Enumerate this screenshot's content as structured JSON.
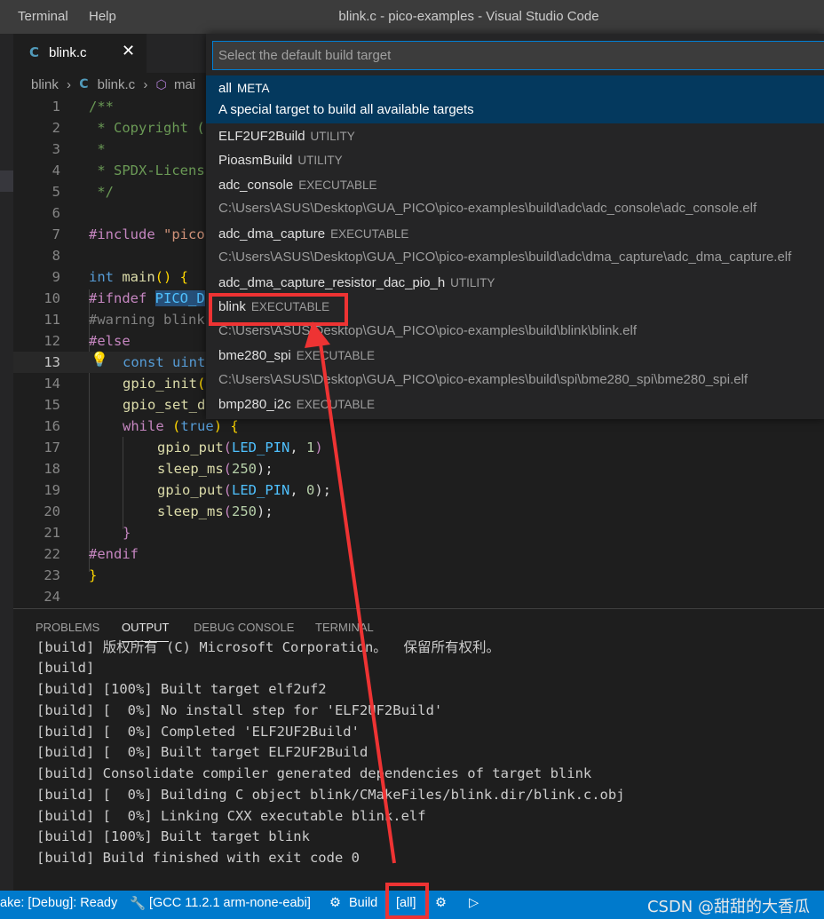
{
  "titlebar": {
    "menu_terminal": "Terminal",
    "menu_help": "Help",
    "title": "blink.c - pico-examples - Visual Studio Code"
  },
  "tab": {
    "icon": "C",
    "label": "blink.c",
    "close": "✕"
  },
  "breadcrumb": {
    "folder": "blink",
    "sep": "›",
    "file": "blink.c",
    "symbol": "mai"
  },
  "editor": {
    "line_numbers": [
      "1",
      "2",
      "3",
      "4",
      "5",
      "6",
      "7",
      "8",
      "9",
      "10",
      "11",
      "12",
      "13",
      "14",
      "15",
      "16",
      "17",
      "18",
      "19",
      "20",
      "21",
      "22",
      "23",
      "24"
    ],
    "lines": {
      "l1": "/**",
      "l2": " * Copyright (",
      "l3": " *",
      "l4": " * SPDX-Licens",
      "l5": " */",
      "l7a": "#include",
      "l7b": " \"pico",
      "l9a": "int",
      "l9b": "main",
      "l9c": "() {",
      "l10a": "#ifndef",
      "l10b": "PICO_D",
      "l11": "#warning blink",
      "l12": "#else",
      "l13a": "const",
      "l13b": " uint",
      "l14a": "gpio_init",
      "l14b": "(",
      "l15": "gpio_set_d",
      "l16a": "while",
      "l16b": "(",
      "l16c": "true",
      "l16d": ") {",
      "l17a": "gpio_put",
      "l17b": "(",
      "l17c": "LED_PIN",
      "l17d": ", ",
      "l17e": "1",
      "l17f": ")",
      "l18a": "sleep_ms",
      "l18b": "(",
      "l18c": "250",
      "l18d": ");",
      "l19a": "gpio_put",
      "l19b": "(",
      "l19c": "LED_PIN",
      "l19d": ", ",
      "l19e": "0",
      "l19f": ");",
      "l20a": "sleep_ms",
      "l20b": "(",
      "l20c": "250",
      "l20d": ");",
      "l21": "}",
      "l22": "#endif",
      "l23": "}"
    },
    "bulb_icon": "lightbulb-icon"
  },
  "panel": {
    "tabs": [
      "PROBLEMS",
      "OUTPUT",
      "DEBUG CONSOLE",
      "TERMINAL"
    ],
    "active_tab": "OUTPUT",
    "output_lines": [
      "[build] 版权所有 (C) Microsoft Corporation。  保留所有权利。",
      "[build]",
      "[build] [100%] Built target elf2uf2",
      "[build] [  0%] No install step for 'ELF2UF2Build'",
      "[build] [  0%] Completed 'ELF2UF2Build'",
      "[build] [  0%] Built target ELF2UF2Build",
      "[build] Consolidate compiler generated dependencies of target blink",
      "[build] [  0%] Building C object blink/CMakeFiles/blink.dir/blink.c.obj",
      "[build] [  0%] Linking CXX executable blink.elf",
      "[build] [100%] Built target blink",
      "[build] Build finished with exit code 0"
    ]
  },
  "quickpick": {
    "placeholder": "Select the default build target",
    "items": [
      {
        "name": "all",
        "tag": "META",
        "desc": "A special target to build all available targets",
        "selected": true
      },
      {
        "name": "ELF2UF2Build",
        "tag": "UTILITY"
      },
      {
        "name": "PioasmBuild",
        "tag": "UTILITY"
      },
      {
        "name": "adc_console",
        "tag": "EXECUTABLE",
        "path": "C:\\Users\\ASUS\\Desktop\\GUA_PICO\\pico-examples\\build\\adc\\adc_console\\adc_console.elf"
      },
      {
        "name": "adc_dma_capture",
        "tag": "EXECUTABLE",
        "path": "C:\\Users\\ASUS\\Desktop\\GUA_PICO\\pico-examples\\build\\adc\\dma_capture\\adc_dma_capture.elf"
      },
      {
        "name": "adc_dma_capture_resistor_dac_pio_h",
        "tag": "UTILITY"
      },
      {
        "name": "blink",
        "tag": "EXECUTABLE",
        "path": "C:\\Users\\ASUS\\Desktop\\GUA_PICO\\pico-examples\\build\\blink\\blink.elf",
        "highlighted": true
      },
      {
        "name": "bme280_spi",
        "tag": "EXECUTABLE",
        "path": "C:\\Users\\ASUS\\Desktop\\GUA_PICO\\pico-examples\\build\\spi\\bme280_spi\\bme280_spi.elf"
      },
      {
        "name": "bmp280_i2c",
        "tag": "EXECUTABLE"
      }
    ]
  },
  "statusbar": {
    "cmake_status": "ake: [Debug]: Ready",
    "kit": "[GCC 11.2.1 arm-none-eabi]",
    "build": "Build",
    "target": "[all]",
    "watermark": "CSDN @甜甜的大香瓜"
  },
  "annotation_color": "#ee3333"
}
